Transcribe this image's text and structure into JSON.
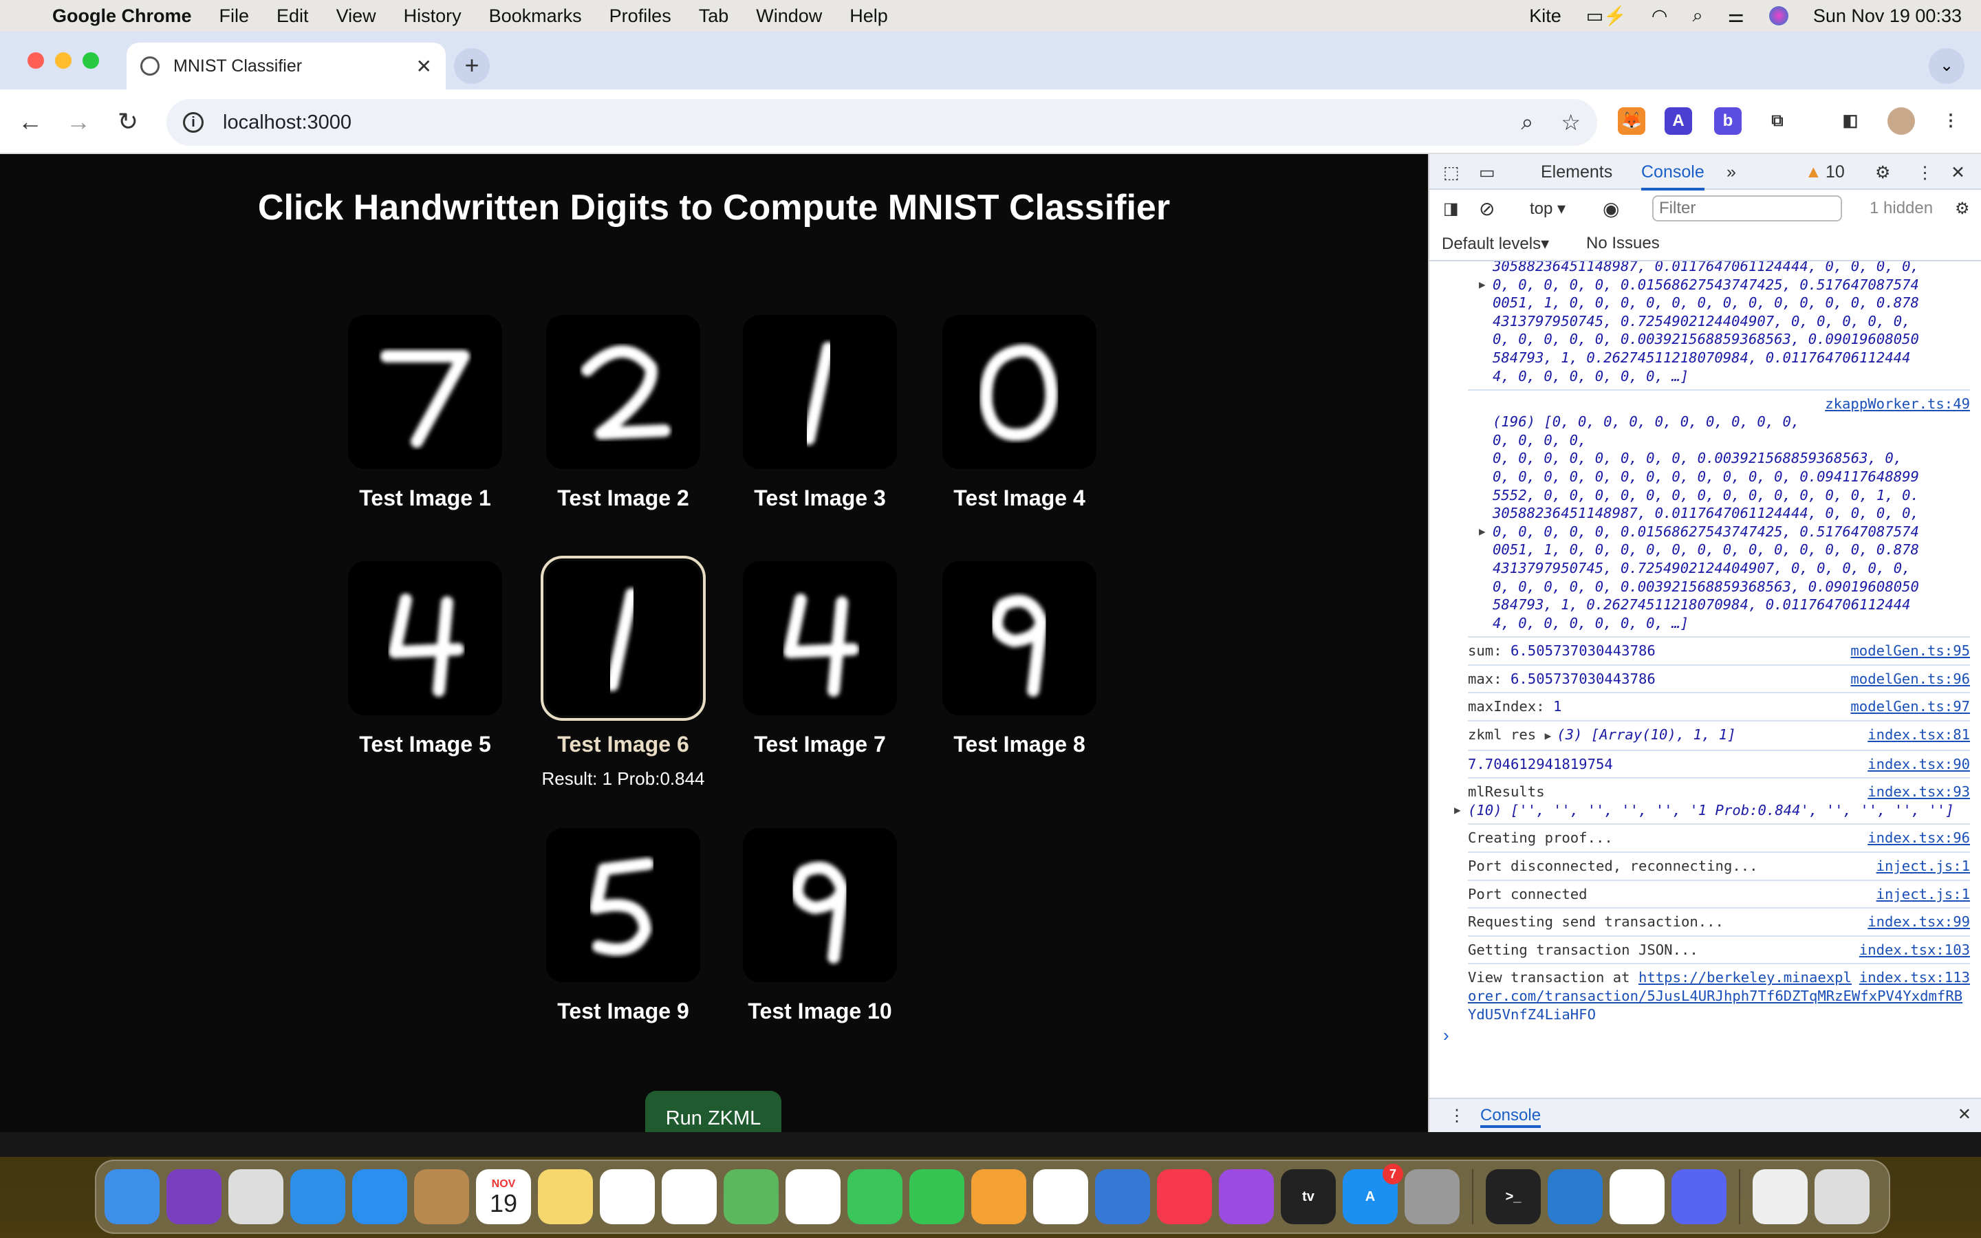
{
  "menubar": {
    "app": "Google Chrome",
    "items": [
      "File",
      "Edit",
      "View",
      "History",
      "Bookmarks",
      "Profiles",
      "Tab",
      "Window",
      "Help"
    ],
    "kite": "Kite",
    "datetime": "Sun Nov 19  00:33"
  },
  "browser": {
    "tab_title": "MNIST Classifier",
    "url": "localhost:3000"
  },
  "page": {
    "title": "Click Handwritten Digits to Compute MNIST Classifier",
    "tiles": [
      {
        "label": "Test Image 1",
        "digit": "7"
      },
      {
        "label": "Test Image 2",
        "digit": "2"
      },
      {
        "label": "Test Image 3",
        "digit": "1"
      },
      {
        "label": "Test Image 4",
        "digit": "0"
      },
      {
        "label": "Test Image 5",
        "digit": "4"
      },
      {
        "label": "Test Image 6",
        "digit": "1",
        "selected": true,
        "result": "Result: 1 Prob:0.844"
      },
      {
        "label": "Test Image 7",
        "digit": "4"
      },
      {
        "label": "Test Image 8",
        "digit": "9"
      },
      {
        "label": "Test Image 9",
        "digit": "5"
      },
      {
        "label": "Test Image 10",
        "digit": "9"
      }
    ],
    "run_button": "Run ZKML",
    "selected_color": "#e8dcc4",
    "button_color": "#1f5b2e"
  },
  "devtools": {
    "tabs": [
      "Elements",
      "Console"
    ],
    "active_tab": "Console",
    "warnings": "10",
    "context": "top",
    "filter_placeholder": "Filter",
    "hidden": "1 hidden",
    "levels": "Default levels",
    "issues": "No Issues",
    "drawer_tab": "Console",
    "console": [
      {
        "src": "",
        "array_lines": [
          "30588236451148987, 0.0117647061124444, 0, 0, 0, 0,",
          "0, 0, 0, 0, 0, 0.01568627543747425, 0.517647087574",
          "0051, 1, 0, 0, 0, 0, 0, 0, 0, 0, 0, 0, 0, 0, 0.878",
          "4313797950745, 0.7254902124404907, 0, 0, 0, 0, 0,",
          "0, 0, 0, 0, 0, 0.003921568859368563, 0.09019608050",
          "584793, 1, 0.2627451121807098​4, 0.011764706112444",
          "4, 0, 0, 0, 0, 0, 0, …]"
        ],
        "tri_line": 1
      },
      {
        "src": "zkappWorker.ts:49",
        "array_lines": [
          "(196) [0, 0, 0, 0, 0, 0, 0, 0, 0, 0, 0, 0, 0, 0,",
          "0, 0, 0, 0, 0, 0, 0, 0, 0.003921568859368563, 0,",
          "0, 0, 0, 0, 0, 0, 0, 0, 0, 0, 0, 0, 0.094117648899",
          "5552, 0, 0, 0, 0, 0, 0, 0, 0, 0, 0, 0, 0, 0, 1, 0.",
          "30588236451148987, 0.0117647061124444, 0, 0, 0, 0,",
          "0, 0, 0, 0, 0, 0.01568627543747425, 0.517647087574",
          "0051, 1, 0, 0, 0, 0, 0, 0, 0, 0, 0, 0, 0, 0, 0.878",
          "4313797950745, 0.7254902124404907, 0, 0, 0, 0, 0,",
          "0, 0, 0, 0, 0, 0.003921568859368563, 0.09019608050",
          "584793, 1, 0.26274511218070984, 0.011764706112444",
          "4, 0, 0, 0, 0, 0, 0, …]"
        ],
        "tri_line": 5
      },
      {
        "src": "modelGen.ts:95",
        "label": "sum: ",
        "value": "6.505737030443786"
      },
      {
        "src": "modelGen.ts:96",
        "label": "max: ",
        "value": "6.505737030443786"
      },
      {
        "src": "modelGen.ts:97",
        "label": "maxIndex: ",
        "value": "1"
      },
      {
        "src": "index.tsx:81",
        "label": "zkml res ",
        "obj": "(3) [Array(10), 1, 1]"
      },
      {
        "src": "index.tsx:90",
        "label": "",
        "value": "7.704612941819754"
      },
      {
        "src": "index.tsx:93",
        "label": "mlResults",
        "obj": "(10) ['', '', '', '', '', '1 Prob:0.844', '', '', '', '']"
      },
      {
        "src": "index.tsx:96",
        "label": "Creating proof..."
      },
      {
        "src": "inject.js:1",
        "label": "Port disconnected, reconnecting..."
      },
      {
        "src": "inject.js:1",
        "label": "Port connected"
      },
      {
        "src": "index.tsx:99",
        "label": "Requesting send transaction..."
      },
      {
        "src": "index.tsx:103",
        "label": "Getting transaction JSON..."
      },
      {
        "src": "index.tsx:113",
        "label": "View transaction at ",
        "link": "https://berkeley.minaexplorer.com/transaction/5JusL4URJhph7Tf6DZTqMRzEWfxPV4YxdmfRBYdU5VnfZ4LiaHFQ"
      }
    ]
  },
  "dock": {
    "apps": [
      "Finder",
      "Siri",
      "Launchpad",
      "Safari",
      "Mail",
      "Contacts",
      "Calendar",
      "Notes",
      "Freeform",
      "Reminders",
      "Maps",
      "Photos",
      "Messages",
      "FaceTime",
      "Pages",
      "Numbers",
      "Keynote",
      "Music",
      "Podcasts",
      "TV",
      "App Store",
      "System Settings",
      "Terminal",
      "VS Code",
      "Chrome",
      "Discord",
      "Downloads",
      "Trash"
    ],
    "calendar_month": "NOV",
    "calendar_day": "19",
    "appstore_badge": "7"
  }
}
